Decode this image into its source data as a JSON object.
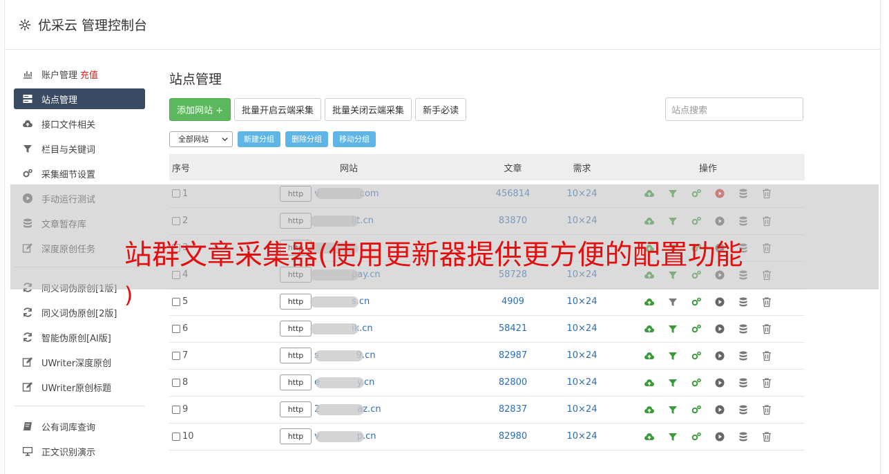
{
  "header": {
    "title": "优采云 管理控制台"
  },
  "sidebar": {
    "items": [
      {
        "label": "账户管理",
        "extra": "充值",
        "icon": "bar-chart-icon"
      },
      {
        "label": "站点管理",
        "icon": "server-icon",
        "active": true
      },
      {
        "label": "接口文件相关",
        "icon": "cloud-upload-icon"
      },
      {
        "label": "栏目与关键词",
        "icon": "filter-icon"
      },
      {
        "label": "采集细节设置",
        "icon": "gears-icon"
      },
      {
        "label": "手动运行测试",
        "icon": "play-circle-icon"
      },
      {
        "label": "文章暂存库",
        "icon": "database-icon"
      },
      {
        "label": "深度原创任务",
        "icon": "edit-icon"
      },
      {
        "label": "同义词伪原创[1版]",
        "icon": "refresh-icon"
      },
      {
        "label": "同义词伪原创[2版]",
        "icon": "refresh-icon"
      },
      {
        "label": "智能伪原创[AI版]",
        "icon": "refresh-icon"
      },
      {
        "label": "UWriter深度原创",
        "icon": "edit-icon"
      },
      {
        "label": "UWriter原创标题",
        "icon": "edit-icon"
      },
      {
        "label": "公有词库查询",
        "icon": "book-icon"
      },
      {
        "label": "正文识别演示",
        "icon": "monitor-icon"
      }
    ]
  },
  "main": {
    "title": "站点管理",
    "buttons": {
      "add": "添加网站 +",
      "batch_on": "批量开启云端采集",
      "batch_off": "批量关闭云端采集",
      "guide": "新手必读"
    },
    "search_placeholder": "站点搜索",
    "group_select": "全部网站",
    "group_buttons": {
      "new": "新建分组",
      "delete": "删除分组",
      "move": "移动分组"
    },
    "table": {
      "headers": [
        "序号",
        "网站",
        "文章",
        "需求",
        "操作"
      ],
      "http_label": "http",
      "rows": [
        {
          "no": "1",
          "site_prefix": "v",
          "site_suffix": ".com",
          "articles": "456814",
          "need": "10×24"
        },
        {
          "no": "2",
          "site_prefix": "",
          "site_suffix": "lit.cn",
          "articles": "83870",
          "need": "10×24"
        },
        {
          "no": "3",
          "site_prefix": "",
          "site_suffix": "",
          "articles": "",
          "need": ""
        },
        {
          "no": "4",
          "site_prefix": "",
          "site_suffix": "pay.cn",
          "articles": "58728",
          "need": "10×24"
        },
        {
          "no": "5",
          "site_prefix": "",
          "site_suffix": "s.cn",
          "articles": "4909",
          "need": "10×24"
        },
        {
          "no": "6",
          "site_prefix": "",
          "site_suffix": "ik.cn",
          "articles": "58421",
          "need": "10×24"
        },
        {
          "no": "7",
          "site_prefix": "s",
          "site_suffix": "9.cn",
          "articles": "82987",
          "need": "10×24"
        },
        {
          "no": "8",
          "site_prefix": "e",
          "site_suffix": "y.cn",
          "articles": "82800",
          "need": "10×24"
        },
        {
          "no": "9",
          "site_prefix": "2",
          "site_suffix": "az.cn",
          "articles": "82837",
          "need": "10×24"
        },
        {
          "no": "10",
          "site_prefix": "v",
          "site_suffix": "p.cn",
          "articles": "82980",
          "need": "10×24"
        }
      ]
    }
  },
  "overlay": {
    "text": "站群文章采集器(使用更新器提供更方便的配置功能",
    "paren": ")"
  },
  "colors": {
    "sidebar_active": "#3b4a63",
    "primary_green": "#5cb85c",
    "link_blue": "#2a6db3",
    "overlay_red": "#e01010"
  }
}
